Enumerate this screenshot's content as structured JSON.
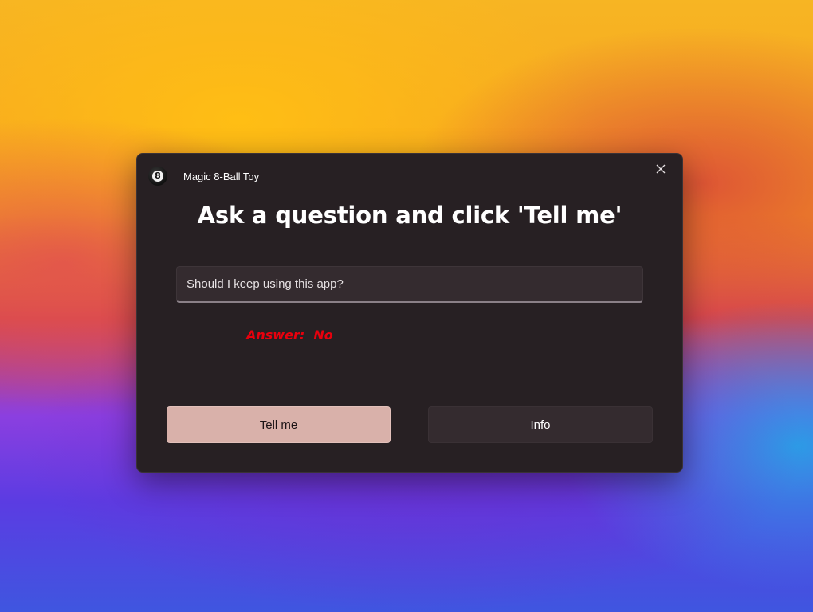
{
  "window": {
    "title": "Magic 8-Ball Toy",
    "app_icon_glyph": "8",
    "close_icon": "close-icon"
  },
  "main": {
    "heading": "Ask a question and click 'Tell me'",
    "question_value": "Should I keep using this app?",
    "answer_text": "Answer:  No",
    "answer_color": "#e8000d"
  },
  "buttons": {
    "tell_me": "Tell me",
    "info": "Info"
  },
  "colors": {
    "window_bg": "#272023",
    "accent_button": "#d9b1aa"
  }
}
